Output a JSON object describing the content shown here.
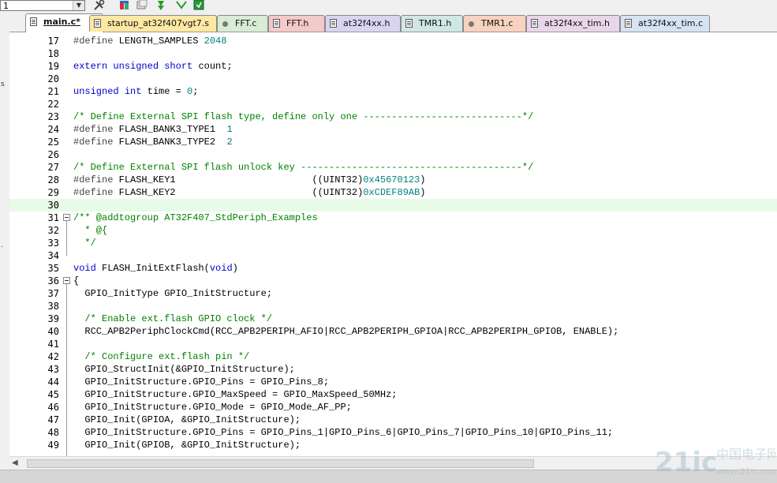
{
  "toolbar": {
    "target_value": "1"
  },
  "tabs": [
    {
      "label": "main.c*",
      "color": "#ffffff",
      "icon": "file-icon",
      "active": true
    },
    {
      "label": "startup_at32f407vgt7.s",
      "color": "#fde9a3",
      "icon": "file-icon"
    },
    {
      "label": "FFT.c",
      "color": "#d9ecd4",
      "icon": "gear-file-icon"
    },
    {
      "label": "FFT.h",
      "color": "#f4c9c9",
      "icon": "file-icon"
    },
    {
      "label": "at32f4xx.h",
      "color": "#d9d5f1",
      "icon": "file-icon"
    },
    {
      "label": "TMR1.h",
      "color": "#cfe8e3",
      "icon": "file-icon"
    },
    {
      "label": "TMR1.c",
      "color": "#f7d3bf",
      "icon": "gear-file-icon"
    },
    {
      "label": "at32f4xx_tim.h",
      "color": "#ead6ea",
      "icon": "file-icon"
    },
    {
      "label": "at32f4xx_tim.c",
      "color": "#d6e3f1",
      "icon": "file-icon"
    }
  ],
  "editor": {
    "current_line": 30,
    "lines": [
      {
        "n": "17",
        "tokens": [
          [
            "pp",
            "#define"
          ],
          [
            "t",
            " LENGTH_SAMPLES "
          ],
          [
            "num",
            "2048"
          ]
        ]
      },
      {
        "n": "18",
        "tokens": []
      },
      {
        "n": "19",
        "tokens": [
          [
            "kw",
            "extern"
          ],
          [
            "t",
            " "
          ],
          [
            "kw",
            "unsigned"
          ],
          [
            "t",
            " "
          ],
          [
            "kw",
            "short"
          ],
          [
            "t",
            " count;"
          ]
        ]
      },
      {
        "n": "20",
        "tokens": []
      },
      {
        "n": "21",
        "tokens": [
          [
            "kw",
            "unsigned"
          ],
          [
            "t",
            " "
          ],
          [
            "kw",
            "int"
          ],
          [
            "t",
            " time = "
          ],
          [
            "num",
            "0"
          ],
          [
            "t",
            ";"
          ]
        ]
      },
      {
        "n": "22",
        "tokens": []
      },
      {
        "n": "23",
        "tokens": [
          [
            "cm",
            "/* Define External SPI flash type, define only one ----------------------------*/"
          ]
        ]
      },
      {
        "n": "24",
        "tokens": [
          [
            "pp",
            "#define"
          ],
          [
            "t",
            " FLASH_BANK3_TYPE1  "
          ],
          [
            "num",
            "1"
          ]
        ]
      },
      {
        "n": "25",
        "tokens": [
          [
            "pp",
            "#define"
          ],
          [
            "t",
            " FLASH_BANK3_TYPE2  "
          ],
          [
            "num",
            "2"
          ]
        ]
      },
      {
        "n": "26",
        "tokens": []
      },
      {
        "n": "27",
        "tokens": [
          [
            "cm",
            "/* Define External SPI flash unlock key ---------------------------------------*/"
          ]
        ]
      },
      {
        "n": "28",
        "tokens": [
          [
            "pp",
            "#define"
          ],
          [
            "t",
            " FLASH_KEY1                        ((UINT32)"
          ],
          [
            "num",
            "0x45670123"
          ],
          [
            "t",
            ")"
          ]
        ]
      },
      {
        "n": "29",
        "tokens": [
          [
            "pp",
            "#define"
          ],
          [
            "t",
            " FLASH_KEY2                        ((UINT32)"
          ],
          [
            "num",
            "0xCDEF89AB"
          ],
          [
            "t",
            ")"
          ]
        ]
      },
      {
        "n": "30",
        "tokens": []
      },
      {
        "n": "31",
        "fold": "open",
        "tokens": [
          [
            "cm",
            "/** @addtogroup AT32F407_StdPeriph_Examples"
          ]
        ]
      },
      {
        "n": "32",
        "tokens": [
          [
            "cm",
            "  * @{"
          ]
        ]
      },
      {
        "n": "33",
        "tokens": [
          [
            "cm",
            "  */"
          ]
        ]
      },
      {
        "n": "34",
        "tokens": []
      },
      {
        "n": "35",
        "tokens": [
          [
            "kw",
            "void"
          ],
          [
            "t",
            " FLASH_InitExtFlash("
          ],
          [
            "kw",
            "void"
          ],
          [
            "t",
            ")"
          ]
        ]
      },
      {
        "n": "36",
        "fold": "open",
        "tokens": [
          [
            "t",
            "{"
          ]
        ]
      },
      {
        "n": "37",
        "tokens": [
          [
            "t",
            "  GPIO_InitType GPIO_InitStructure;"
          ]
        ]
      },
      {
        "n": "38",
        "tokens": []
      },
      {
        "n": "39",
        "tokens": [
          [
            "t",
            "  "
          ],
          [
            "cm",
            "/* Enable ext.flash GPIO clock */"
          ]
        ]
      },
      {
        "n": "40",
        "tokens": [
          [
            "t",
            "  RCC_APB2PeriphClockCmd(RCC_APB2PERIPH_AFIO|RCC_APB2PERIPH_GPIOA|RCC_APB2PERIPH_GPIOB, ENABLE);"
          ]
        ]
      },
      {
        "n": "41",
        "tokens": []
      },
      {
        "n": "42",
        "tokens": [
          [
            "t",
            "  "
          ],
          [
            "cm",
            "/* Configure ext.flash pin */"
          ]
        ]
      },
      {
        "n": "43",
        "tokens": [
          [
            "t",
            "  GPIO_StructInit(&GPIO_InitStructure);"
          ]
        ]
      },
      {
        "n": "44",
        "tokens": [
          [
            "t",
            "  GPIO_InitStructure.GPIO_Pins = GPIO_Pins_8;"
          ]
        ]
      },
      {
        "n": "45",
        "tokens": [
          [
            "t",
            "  GPIO_InitStructure.GPIO_MaxSpeed = GPIO_MaxSpeed_50MHz;"
          ]
        ]
      },
      {
        "n": "46",
        "tokens": [
          [
            "t",
            "  GPIO_InitStructure.GPIO_Mode = GPIO_Mode_AF_PP;"
          ]
        ]
      },
      {
        "n": "47",
        "tokens": [
          [
            "t",
            "  GPIO_Init(GPIOA, &GPIO_InitStructure);"
          ]
        ]
      },
      {
        "n": "48",
        "tokens": [
          [
            "t",
            "  GPIO_InitStructure.GPIO_Pins = GPIO_Pins_1|GPIO_Pins_6|GPIO_Pins_7|GPIO_Pins_10|GPIO_Pins_11;"
          ]
        ]
      },
      {
        "n": "49",
        "tokens": [
          [
            "t",
            "  GPIO_Init(GPIOB, &GPIO_InitStructure);"
          ]
        ]
      }
    ]
  },
  "left_panel": {
    "ticks": [
      "s",
      "."
    ]
  },
  "watermark": {
    "text": "21ic",
    "subtext": "中国电子网",
    "url": "www.21ic.com"
  }
}
